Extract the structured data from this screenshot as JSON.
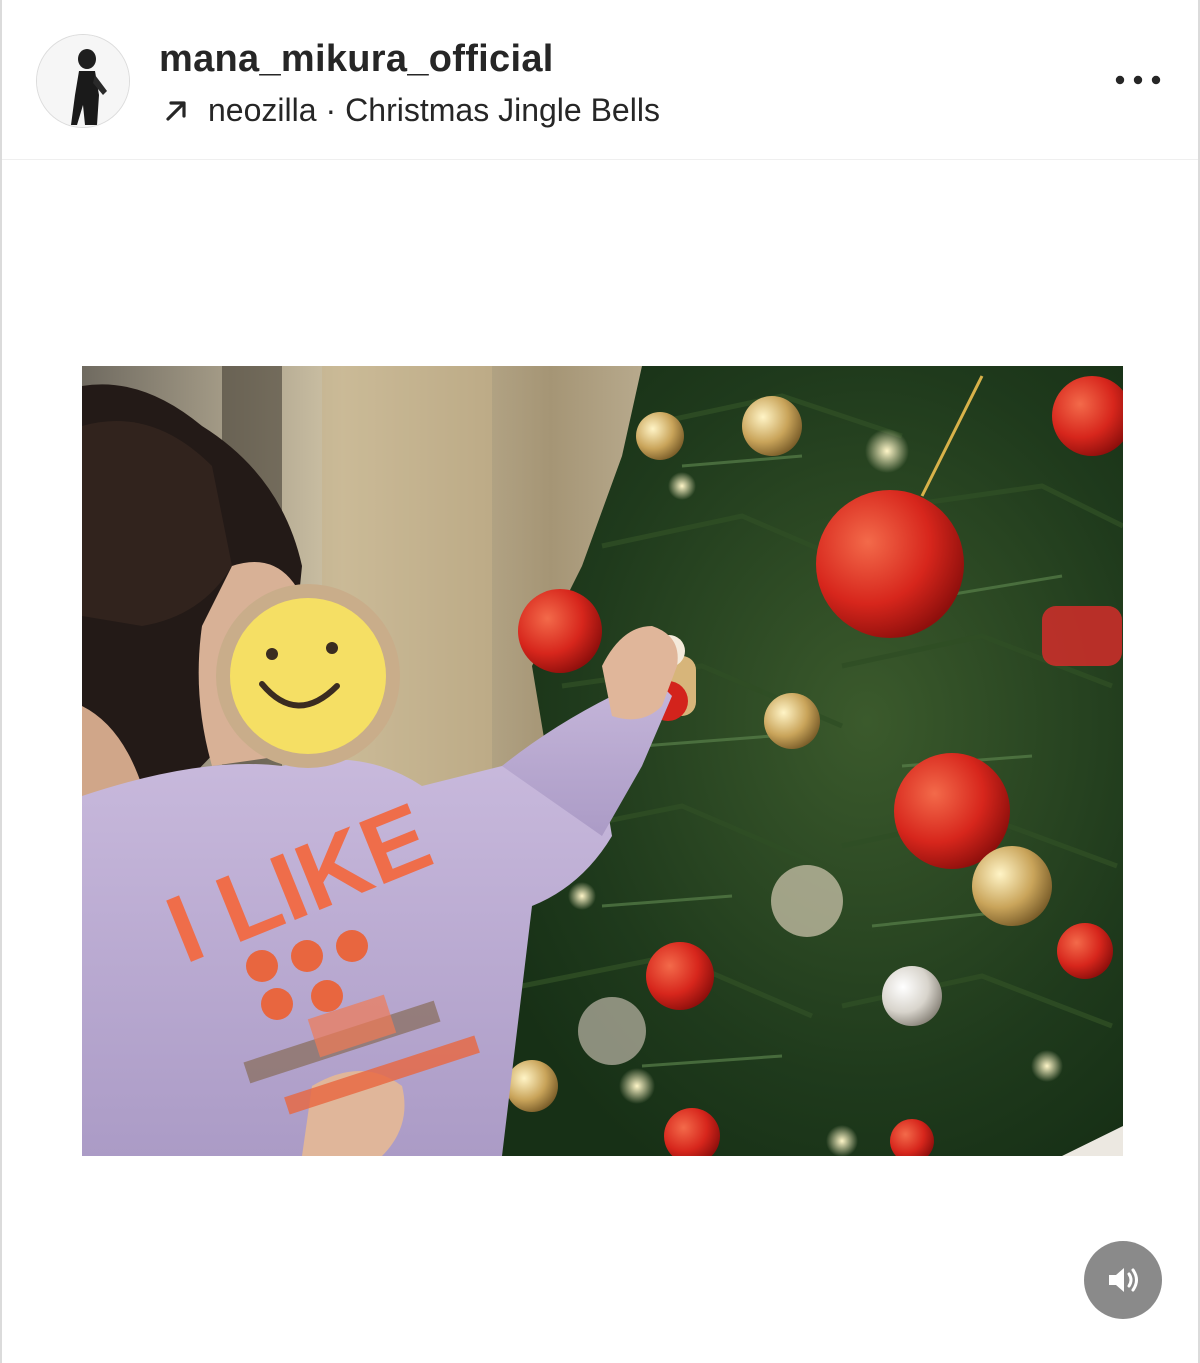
{
  "post": {
    "username": "mana_mikura_official",
    "audio": {
      "artist": "neozilla",
      "separator": "·",
      "track": "Christmas Jingle Bells"
    }
  },
  "icons": {
    "audio_link": "arrow-up-right-icon",
    "more": "more-options-icon",
    "sound": "volume-icon"
  },
  "photo_text": {
    "shirt_print": "I LIKE"
  },
  "colors": {
    "text": "#262626",
    "sound_button": "#8a8a8a",
    "border": "#dbdbdb"
  }
}
